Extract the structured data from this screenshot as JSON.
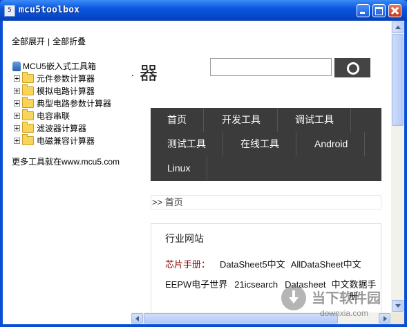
{
  "window": {
    "title": "mcu5toolbox",
    "icon_text": "5"
  },
  "tree": {
    "expand_all": "全部展开",
    "separator": "|",
    "collapse_all": "全部折叠",
    "root_label": "MCU5嵌入式工具箱",
    "nodes": [
      "元件参数计算器",
      "模拟电路计算器",
      "典型电路参数计算器",
      "电容串联",
      "滤波器计算器",
      "电磁兼容计算器"
    ],
    "more_text": "更多工具就在www.mcu5.com"
  },
  "web": {
    "logo_dot": ".",
    "logo_char": "器",
    "nav": [
      "首页",
      "开发工具",
      "调试工具",
      "测试工具",
      "在线工具",
      "Android",
      "Linux"
    ],
    "breadcrumb": ">> 首页",
    "panel_title": "行业网站",
    "chip_label": "芯片手册：",
    "links_row1": [
      "DataSheet5中文",
      "AllDataSheet中文"
    ],
    "links_row2": [
      "EEPW电子世界",
      "21icsearch",
      "Datasheet",
      "中文数据手"
    ],
    "links_row2_tail": "册"
  },
  "watermark": {
    "text": "当下软件园",
    "url": "downxia.com"
  }
}
